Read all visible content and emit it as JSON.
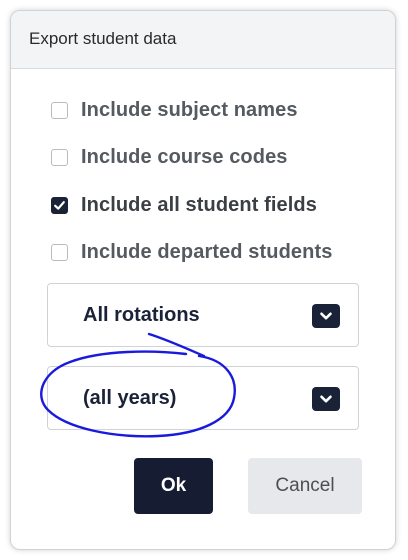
{
  "dialog": {
    "title": "Export student data"
  },
  "options": [
    {
      "label": "Include subject names",
      "checked": false
    },
    {
      "label": "Include course codes",
      "checked": false
    },
    {
      "label": "Include all student fields",
      "checked": true
    },
    {
      "label": "Include departed students",
      "checked": false
    }
  ],
  "rotation_select": {
    "value": "All rotations",
    "icon": "chevron-down-icon"
  },
  "year_select": {
    "value": "(all years)",
    "icon": "chevron-down-icon"
  },
  "buttons": {
    "ok_label": "Ok",
    "cancel_label": "Cancel"
  },
  "colors": {
    "primary": "#161d33",
    "secondary_button": "#e6e8eb",
    "annotation_ink": "#1a1adc"
  }
}
